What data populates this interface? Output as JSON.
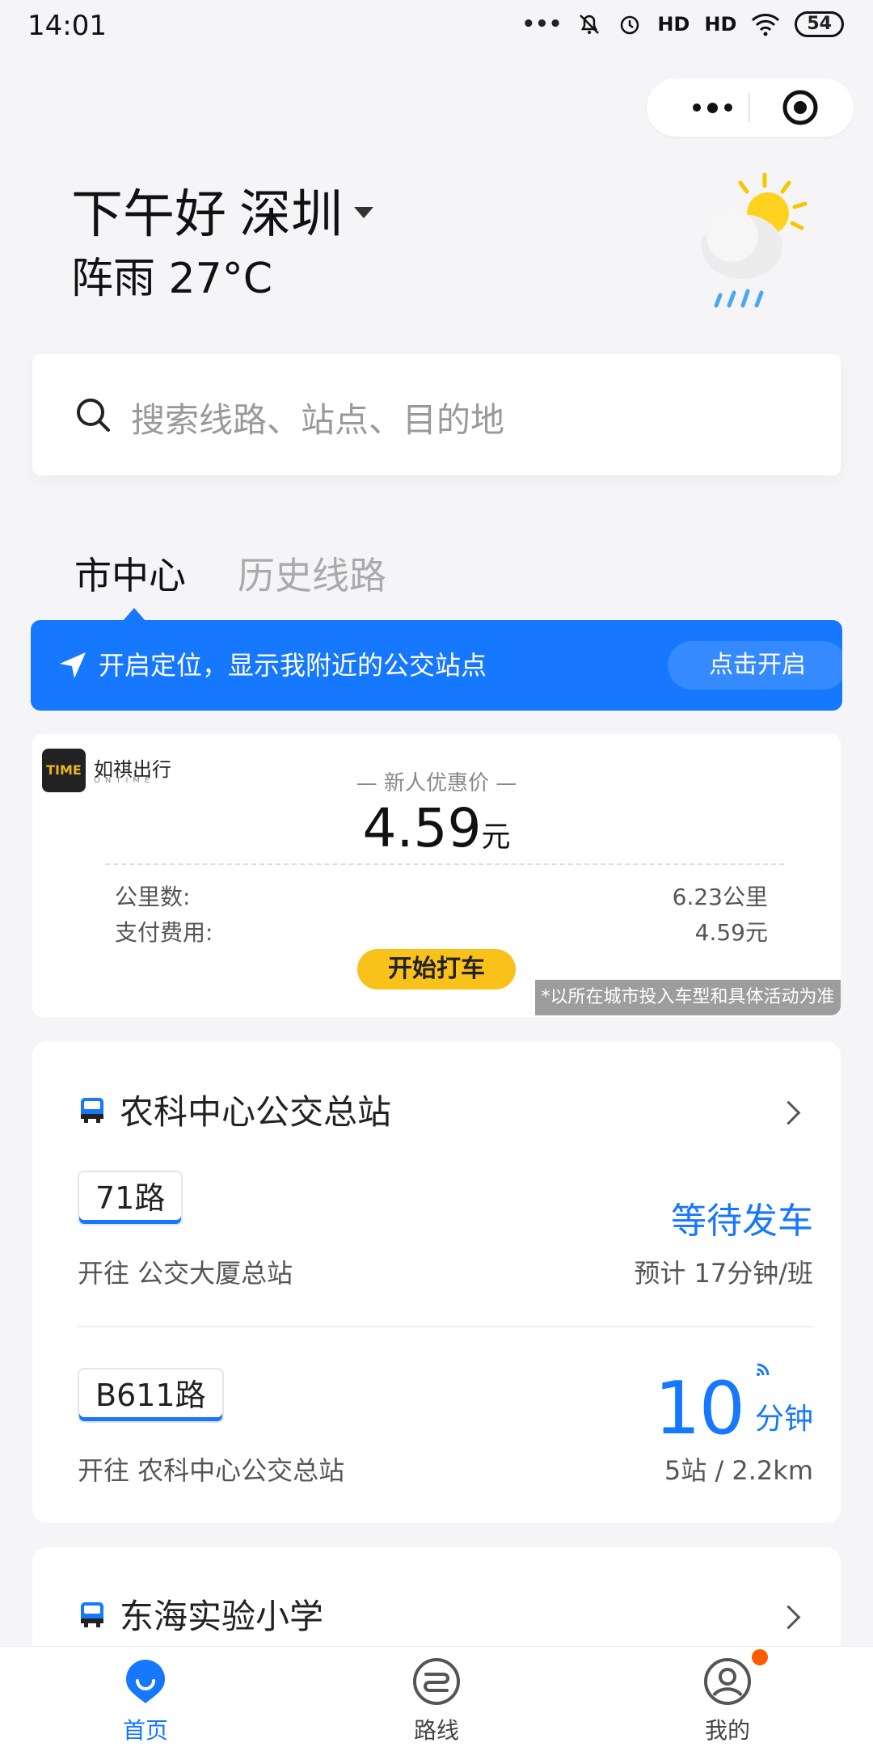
{
  "status_bar": {
    "time": "14:01",
    "battery": "54",
    "signal1": "HD",
    "signal2": "HD"
  },
  "header": {
    "greeting": "下午好",
    "city": "深圳",
    "weather": "阵雨 27°C"
  },
  "search": {
    "placeholder": "搜索线路、站点、目的地"
  },
  "tabs": [
    {
      "label": "市中心"
    },
    {
      "label": "历史线路"
    }
  ],
  "location_banner": {
    "text": "开启定位，显示我附近的公交站点",
    "button": "点击开启"
  },
  "ad": {
    "brand": "如祺出行",
    "brand_en": "ONTIME",
    "logo_text": "TIME",
    "promo_label": "— 新人优惠价 —",
    "price": "4.59",
    "price_unit": "元",
    "rows": [
      {
        "label": "公里数:",
        "value": "6.23公里"
      },
      {
        "label": "支付费用:",
        "value": "4.59元"
      }
    ],
    "button": "开始打车",
    "disclaimer": "*以所在城市投入车型和具体活动为准"
  },
  "stations": [
    {
      "name": "农科中心公交总站",
      "routes": [
        {
          "route": "71路",
          "direction": "开往 公交大厦总站",
          "status": "等待发车",
          "sub": "预计 17分钟/班"
        },
        {
          "route": "B611路",
          "direction": "开往 农科中心公交总站",
          "eta": "10",
          "eta_unit": "分钟",
          "sub": "5站 / 2.2km"
        }
      ]
    },
    {
      "name": "东海实验小学"
    }
  ],
  "nav": [
    {
      "label": "首页",
      "icon": "home-icon"
    },
    {
      "label": "路线",
      "icon": "route-icon"
    },
    {
      "label": "我的",
      "icon": "profile-icon"
    }
  ],
  "colors": {
    "accent": "#1677ff",
    "yellow": "#f9c21b",
    "badge": "#ff5a00"
  }
}
